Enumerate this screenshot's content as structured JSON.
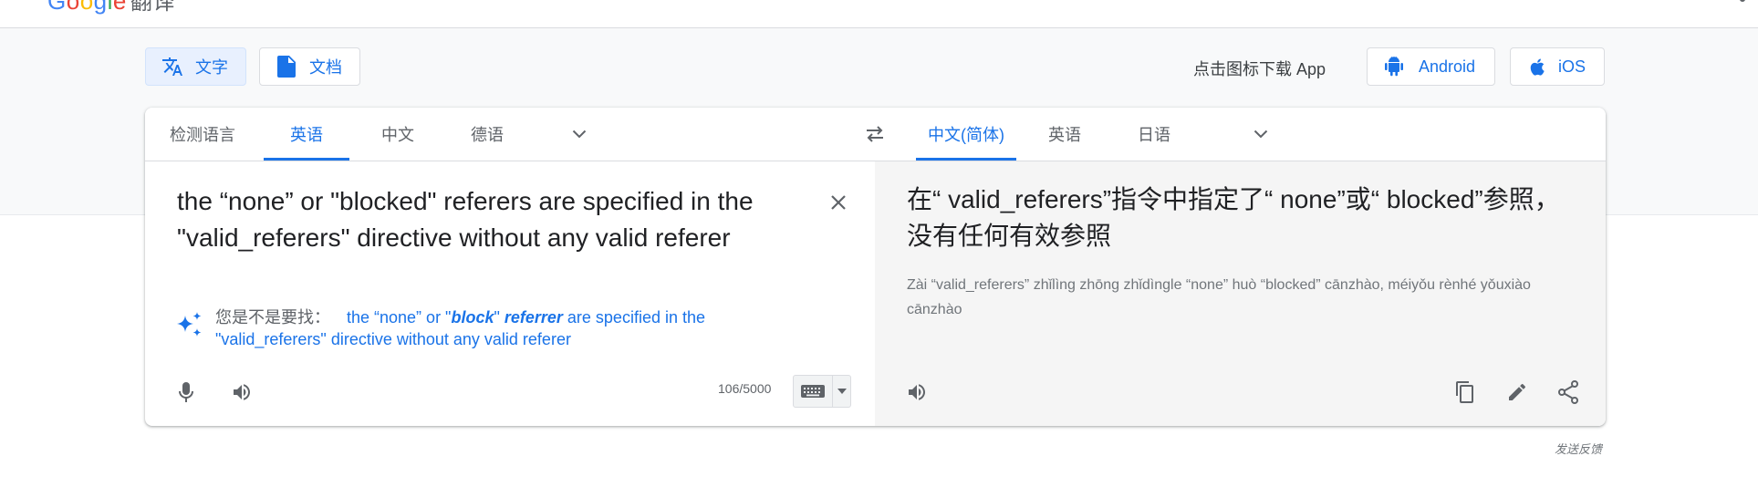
{
  "header": {
    "logo_letters": [
      "G",
      "o",
      "o",
      "g",
      "l",
      "e"
    ],
    "product_name": "翻译"
  },
  "modes": {
    "text_label": "文字",
    "docs_label": "文档",
    "text_icon": "translate-icon",
    "docs_icon": "document-icon"
  },
  "app_download": {
    "label": "点击图标下载 App",
    "android_label": "Android",
    "ios_label": "iOS"
  },
  "source_langs": {
    "items": [
      "检测语言",
      "英语",
      "中文",
      "德语"
    ],
    "selected": "英语"
  },
  "target_langs": {
    "items": [
      "中文(简体)",
      "英语",
      "日语"
    ],
    "selected": "中文(简体)"
  },
  "source": {
    "text": "the “none” or \"blocked\" referers are specified in the \"valid_referers\" directive without any valid referer",
    "char_count": "106/5000"
  },
  "suggestion": {
    "label": "您是不是要找：",
    "part1": "the “none” or \"",
    "bold1": "block",
    "part2": "\" ",
    "bold2": "referrer",
    "part3": " are specified in the \"valid_referers\" directive without any valid referer"
  },
  "target": {
    "text": "在“ valid_referers”指令中指定了“ none”或“ blocked”参照，没有任何有效参照",
    "transliteration": "Zài “valid_referers” zhǐlìng zhōng zhǐdìngle “none” huò “blocked” cānzhào, méiyǒu rènhé yǒuxiào cānzhào"
  },
  "feedback_label": "发送反馈",
  "colors": {
    "accent": "#1a73e8",
    "text": "#202124",
    "muted": "#5f6368",
    "band": "#f8f9fa",
    "target_bg": "#f5f5f5"
  }
}
